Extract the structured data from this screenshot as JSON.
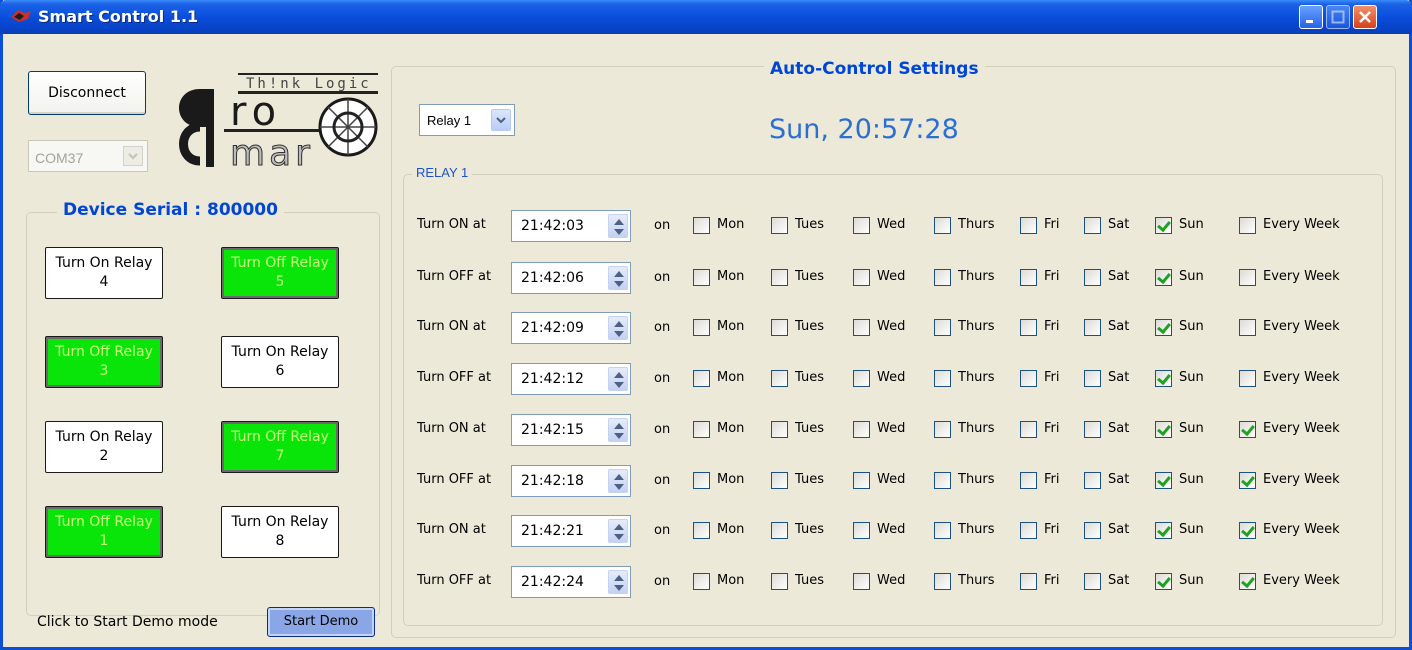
{
  "window": {
    "title": "Smart Control 1.1"
  },
  "connection": {
    "disconnect_label": "Disconnect",
    "port": "COM37"
  },
  "logo": {
    "text_top": "Th!nk Logic",
    "text_mid": "ro",
    "text_bot": "mar"
  },
  "device": {
    "serial_label": "Device Serial : 800000",
    "relays": [
      {
        "label1": "Turn On Relay",
        "label2": "4",
        "state": "off"
      },
      {
        "label1": "Turn Off Relay",
        "label2": "5",
        "state": "on"
      },
      {
        "label1": "Turn Off Relay",
        "label2": "3",
        "state": "on"
      },
      {
        "label1": "Turn On Relay",
        "label2": "6",
        "state": "off"
      },
      {
        "label1": "Turn On Relay",
        "label2": "2",
        "state": "off"
      },
      {
        "label1": "Turn Off Relay",
        "label2": "7",
        "state": "on"
      },
      {
        "label1": "Turn Off Relay",
        "label2": "1",
        "state": "on"
      },
      {
        "label1": "Turn On Relay",
        "label2": "8",
        "state": "off"
      }
    ]
  },
  "demo": {
    "label": "Click to Start Demo mode",
    "button": "Start Demo"
  },
  "auto": {
    "title": "Auto-Control Settings",
    "selected_relay": "Relay 1",
    "clock": "Sun, 20:57:28",
    "group_title": "RELAY 1",
    "on_word": "on",
    "days": [
      "Mon",
      "Tues",
      "Wed",
      "Thurs",
      "Fri",
      "Sat",
      "Sun",
      "Every Week"
    ],
    "schedules": [
      {
        "label": "Turn ON at",
        "time": "21:42:03",
        "checked": [
          false,
          false,
          false,
          false,
          false,
          false,
          true,
          false
        ]
      },
      {
        "label": "Turn OFF at",
        "time": "21:42:06",
        "checked": [
          false,
          false,
          false,
          false,
          false,
          false,
          true,
          false
        ]
      },
      {
        "label": "Turn ON at",
        "time": "21:42:09",
        "checked": [
          false,
          false,
          false,
          false,
          false,
          false,
          true,
          false
        ]
      },
      {
        "label": "Turn OFF at",
        "time": "21:42:12",
        "checked": [
          false,
          false,
          false,
          false,
          false,
          false,
          true,
          false
        ]
      },
      {
        "label": "Turn ON at",
        "time": "21:42:15",
        "checked": [
          false,
          false,
          false,
          false,
          false,
          false,
          true,
          true
        ]
      },
      {
        "label": "Turn OFF at",
        "time": "21:42:18",
        "checked": [
          false,
          false,
          false,
          false,
          false,
          false,
          true,
          true
        ]
      },
      {
        "label": "Turn ON at",
        "time": "21:42:21",
        "checked": [
          false,
          false,
          false,
          false,
          false,
          false,
          true,
          true
        ]
      },
      {
        "label": "Turn OFF at",
        "time": "21:42:24",
        "checked": [
          false,
          false,
          false,
          false,
          false,
          false,
          true,
          true
        ]
      }
    ]
  },
  "colors": {
    "accent": "#0046d5",
    "relay_on": "#09e509",
    "titlebar": "#0a4edb"
  }
}
